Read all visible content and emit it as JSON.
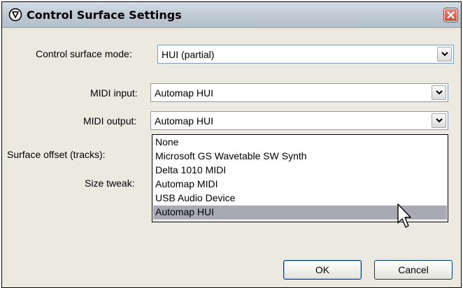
{
  "window": {
    "title": "Control Surface Settings"
  },
  "form": {
    "mode_label": "Control surface mode:",
    "mode_value": "HUI (partial)",
    "midi_input_label": "MIDI input:",
    "midi_input_value": "Automap HUI",
    "midi_output_label": "MIDI output:",
    "midi_output_value": "Automap HUI",
    "surface_offset_label": "Surface offset (tracks):",
    "size_tweak_label": "Size tweak:"
  },
  "dropdown": {
    "items": [
      "None",
      "Microsoft GS Wavetable SW Synth",
      "Delta 1010 MIDI",
      "Automap MIDI",
      "USB Audio Device",
      "Automap HUI"
    ],
    "selected": "Automap HUI"
  },
  "buttons": {
    "ok": "OK",
    "cancel": "Cancel"
  },
  "icons": {
    "app": "reaper-app-icon",
    "close": "close-icon",
    "dropdown": "chevron-down-icon",
    "cursor": "mouse-pointer-icon"
  },
  "colors": {
    "selected_item": "#a9a9b4",
    "close_button": "#c44e3c"
  }
}
